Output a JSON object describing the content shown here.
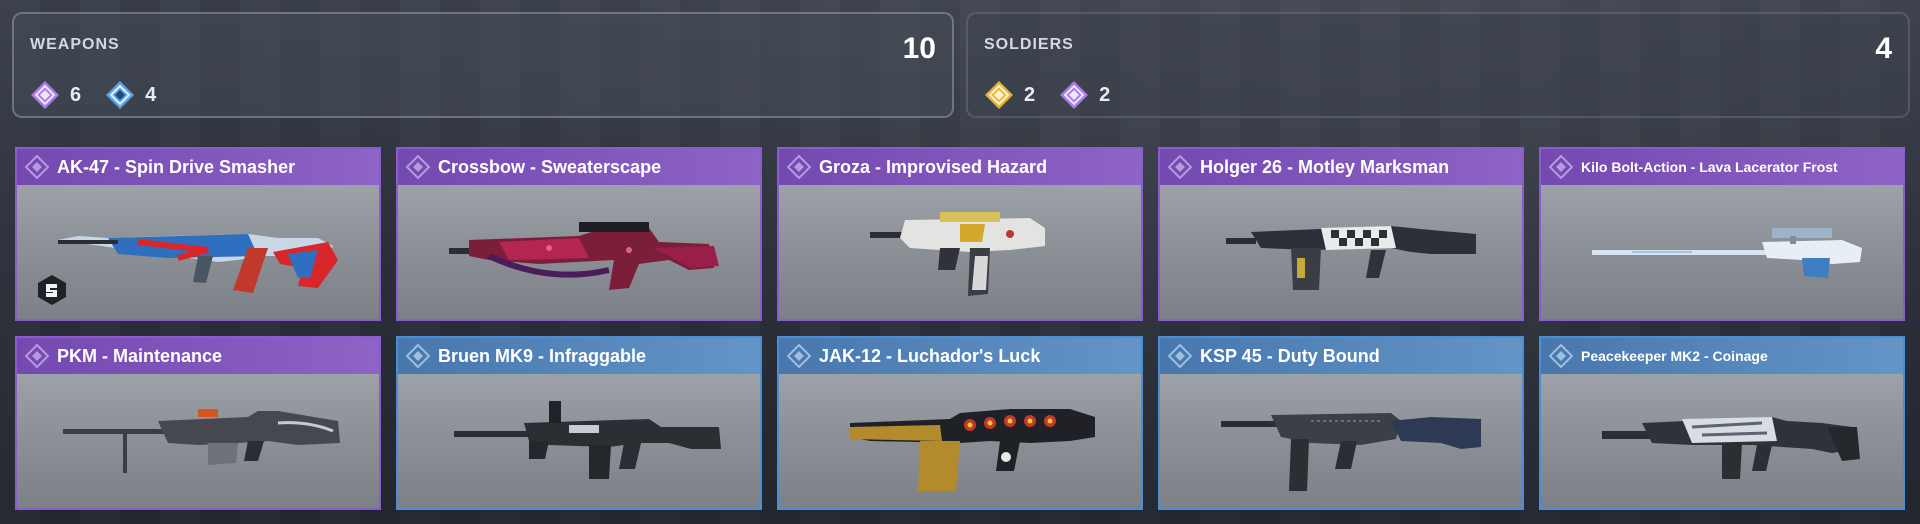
{
  "weapons_summary": {
    "label": "WEAPONS",
    "total": "10",
    "counts": [
      {
        "rarity": "legendary-purple",
        "icon": "diamond-rarity-icon",
        "color": "#a97be6",
        "value": "6"
      },
      {
        "rarity": "rare-blue",
        "icon": "diamond-rarity-icon",
        "color": "#5aa2e6",
        "value": "4"
      }
    ]
  },
  "soldiers_summary": {
    "label": "SOLDIERS",
    "total": "4",
    "counts": [
      {
        "rarity": "gold",
        "icon": "diamond-rarity-icon",
        "color": "#e4b53a",
        "value": "2"
      },
      {
        "rarity": "legendary-purple",
        "icon": "diamond-rarity-icon",
        "color": "#a97be6",
        "value": "2"
      }
    ]
  },
  "colors": {
    "purple_border": "#8a5ccf",
    "blue_border": "#4a8fd6",
    "purple_title": "#7449b0",
    "blue_title": "#4777ad"
  },
  "weapons": [
    {
      "name": "AK-47 - Spin Drive Smasher",
      "rarity": "purple",
      "gun_icon": "assault-rifle-icon",
      "has_badge": true
    },
    {
      "name": "Crossbow - Sweaterscape",
      "rarity": "purple",
      "gun_icon": "crossbow-icon"
    },
    {
      "name": "Groza - Improvised Hazard",
      "rarity": "purple",
      "gun_icon": "bullpup-rifle-icon"
    },
    {
      "name": "Holger 26 - Motley Marksman",
      "rarity": "purple",
      "gun_icon": "lmg-icon"
    },
    {
      "name": "Kilo Bolt-Action - Lava Lacerator Frost",
      "rarity": "purple",
      "gun_icon": "sniper-rifle-icon"
    },
    {
      "name": "PKM - Maintenance",
      "rarity": "purple",
      "gun_icon": "machine-gun-icon"
    },
    {
      "name": "Bruen MK9 - Infraggable",
      "rarity": "blue",
      "gun_icon": "machine-gun-icon"
    },
    {
      "name": "JAK-12 - Luchador's Luck",
      "rarity": "blue",
      "gun_icon": "shotgun-icon"
    },
    {
      "name": "KSP 45 - Duty Bound",
      "rarity": "blue",
      "gun_icon": "smg-icon"
    },
    {
      "name": "Peacekeeper MK2 - Coinage",
      "rarity": "blue",
      "gun_icon": "assault-rifle-icon"
    }
  ]
}
